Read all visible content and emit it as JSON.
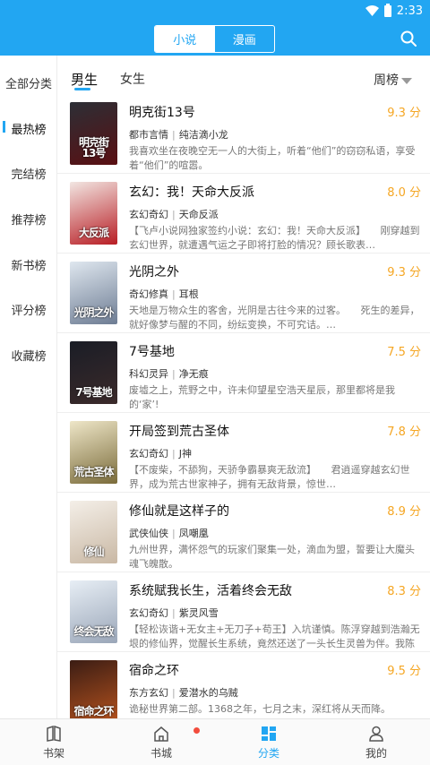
{
  "status": {
    "time": "2:33"
  },
  "header": {
    "tabs": [
      "小说",
      "漫画"
    ],
    "active_tab": 0,
    "accent": "#22a6f2"
  },
  "sidebar": {
    "items": [
      "全部分类",
      "最热榜",
      "完结榜",
      "推荐榜",
      "新书榜",
      "评分榜",
      "收藏榜"
    ],
    "active": 1
  },
  "gender_tabs": {
    "items": [
      "男生",
      "女生"
    ],
    "active": 0
  },
  "sort": {
    "label": "周榜"
  },
  "books": [
    {
      "title": "明克街13号",
      "score": "9.3 分",
      "category": "都市言情",
      "author": "纯洁滴小龙",
      "desc": "我喜欢坐在夜晚空无一人的大街上，听着“他们”的窃窃私语，享受着“他们”的喧嚣。",
      "cover_text": "明克街13号",
      "cover_colors": [
        "#2c2f36",
        "#5a0f12"
      ]
    },
    {
      "title": "玄幻：我！天命大反派",
      "score": "8.0 分",
      "category": "玄幻奇幻",
      "author": "天命反派",
      "desc": "【飞卢小说网独家签约小说：玄幻：我！天命大反派】　　刚穿越到玄幻世界，就遭遇气运之子即将打脸的情况？顾长歌表…",
      "cover_text": "大反派",
      "cover_colors": [
        "#f2e6e2",
        "#b81d24"
      ]
    },
    {
      "title": "光阴之外",
      "score": "9.3 分",
      "category": "奇幻修真",
      "author": "耳根",
      "desc": "天地是万物众生的客舍，光阴是古往今来的过客。　　死生的差异，就好像梦与醒的不同，纷纭变换，不可究诘。…",
      "cover_text": "光阴之外",
      "cover_colors": [
        "#dfe7ef",
        "#6d7c93"
      ]
    },
    {
      "title": "7号基地",
      "score": "7.5 分",
      "category": "科幻灵异",
      "author": "净无痕",
      "desc": "废墟之上，荒野之中，许未仰望星空浩天星辰，那里都将是我的‘家’!",
      "cover_text": "7号基地",
      "cover_colors": [
        "#1a1d26",
        "#3b2a2a"
      ]
    },
    {
      "title": "开局签到荒古圣体",
      "score": "7.8 分",
      "category": "玄幻奇幻",
      "author": "J神",
      "desc": "【不废柴，不舔狗，天骄争霸暴爽无敌流】　　君逍遥穿越玄幻世界，成为荒古世家神子，拥有无敌背景，惊世…",
      "cover_text": "荒古圣体",
      "cover_colors": [
        "#eee6c8",
        "#7a6b3a"
      ]
    },
    {
      "title": "修仙就是这样子的",
      "score": "8.9 分",
      "category": "武侠仙侠",
      "author": "凤嘲凰",
      "desc": "九州世界，满怀怨气的玩家们聚集一处，滴血为盟，誓要让大魔头魂飞魄散。",
      "cover_text": "修仙",
      "cover_colors": [
        "#f4efe8",
        "#c9b8a4"
      ]
    },
    {
      "title": "系统赋我长生，活着终会无敌",
      "score": "8.3 分",
      "category": "玄幻奇幻",
      "author": "紫灵风雪",
      "desc": "【轻松诙谐+无女主+无刀子+苟王】入坑谨慎。陈浮穿越到浩瀚无垠的修仙界，觉醒长生系统，竟然还送了一头长生灵兽为伴。我陈浮对…",
      "cover_text": "终会无敌",
      "cover_colors": [
        "#e7eef5",
        "#9aa6b8"
      ]
    },
    {
      "title": "宿命之环",
      "score": "9.5 分",
      "category": "东方玄幻",
      "author": "爱潜水的乌贼",
      "desc": "诡秘世界第二部。1368之年，七月之末，深红将从天而降。",
      "cover_text": "宿命之环",
      "cover_colors": [
        "#3b1d14",
        "#b5521e"
      ]
    }
  ],
  "bottom_nav": {
    "items": [
      {
        "label": "书架",
        "icon": "bookshelf-icon"
      },
      {
        "label": "书城",
        "icon": "store-icon",
        "badge": true
      },
      {
        "label": "分类",
        "icon": "category-icon"
      },
      {
        "label": "我的",
        "icon": "profile-icon"
      }
    ],
    "active": 2
  }
}
